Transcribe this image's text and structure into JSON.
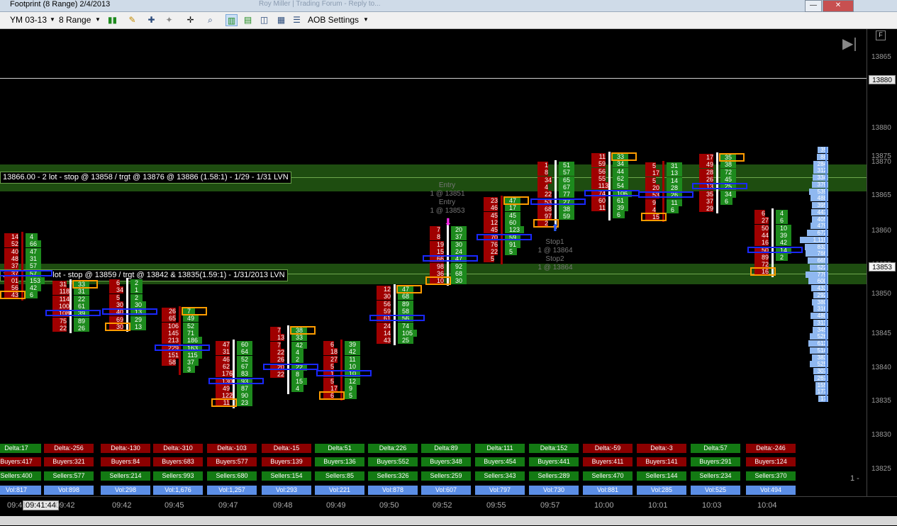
{
  "window": {
    "title": "Footprint (8 Range)  2/4/2013",
    "background_tab_text": "Roy Miller | Trading Forum - Reply to...",
    "min_label": "—",
    "close_label": "✕"
  },
  "toolbar": {
    "instrument": "YM 03-13",
    "period": "8 Range",
    "settings_label": "AOB Settings"
  },
  "price_axis": {
    "ticks": [
      "13865",
      "13880",
      "13875",
      "13870",
      "13865",
      "13860",
      "13855",
      "13850",
      "13845",
      "13840",
      "13835",
      "13830",
      "13825"
    ],
    "current_price": "13853",
    "ref_price": "13880",
    "f_label": "F"
  },
  "chart": {
    "trade_label_upper": "13866.00 - 2 lot - stop @ 13858 / trgt @ 13876 @ 13886 (1.58:1) - 1/29 - 1/31 LVN",
    "trade_label_lower_a": "13 ",
    "trade_label_lower_b": "lot - sto",
    "trade_label_lower_c": "p @ 13859 / trgt @ 13842 & 13835(1.59:1) - 1/31/2013 LVN",
    "entry1": "Entry",
    "entry1_price": "1 @ 13851",
    "entry2": "Entry",
    "entry2_price": "1 @ 13853",
    "stop1": "Stop1",
    "stop1_price": "1 @ 13864",
    "stop2": "Stop2",
    "stop2_price": "1 @ 13864",
    "pager": "1 -",
    "colors": {
      "bid": "#a00000",
      "ask": "#1d8a1d",
      "poc": "#1a28ff",
      "imbalance": "#ff9c00",
      "profile": "#8fb8f0"
    }
  },
  "bars": [
    {
      "bid": [
        "14",
        "52",
        "40",
        "48",
        "37",
        "37",
        "01",
        "56",
        "43"
      ],
      "ask": [
        "4",
        "66",
        "47",
        "31",
        "57",
        "57",
        "153",
        "42",
        "6"
      ]
    },
    {
      "bid": [
        "31",
        "118",
        "114",
        "100",
        "108",
        "75",
        "22"
      ],
      "ask": [
        "33",
        "31",
        "22",
        "61",
        "39",
        "89",
        "26"
      ]
    },
    {
      "bid": [
        "6",
        "34",
        "5",
        "30",
        "40",
        "69",
        "30"
      ],
      "ask": [
        "2",
        "1",
        "2",
        "30",
        "13",
        "29",
        "13"
      ]
    },
    {
      "bid": [
        "26",
        "65",
        "106",
        "145",
        "213",
        "229",
        "151",
        "58"
      ],
      "ask": [
        "7",
        "49",
        "52",
        "71",
        "186",
        "163",
        "115",
        "37",
        "3"
      ]
    },
    {
      "bid": [
        "47",
        "31",
        "46",
        "62",
        "176",
        "130",
        "49",
        "122",
        "11"
      ],
      "ask": [
        "60",
        "64",
        "52",
        "67",
        "83",
        "93",
        "87",
        "90",
        "23"
      ]
    },
    {
      "bid": [
        "7",
        "13",
        "7",
        "22",
        "26",
        "20",
        "22"
      ],
      "ask": [
        "38",
        "33",
        "42",
        "4",
        "2",
        "22",
        "8",
        "15",
        "4"
      ]
    },
    {
      "bid": [
        "6",
        "18",
        "27",
        "5",
        "1",
        "5",
        "17",
        "6"
      ],
      "ask": [
        "39",
        "42",
        "11",
        "10",
        "10",
        "12",
        "9",
        "5"
      ]
    },
    {
      "bid": [
        "12",
        "30",
        "56",
        "59",
        "61",
        "24",
        "14",
        "43"
      ],
      "ask": [
        "47",
        "68",
        "89",
        "58",
        "56",
        "74",
        "105",
        "25"
      ]
    },
    {
      "bid": [
        "7",
        "8",
        "19",
        "15",
        "66",
        "98",
        "36",
        "10"
      ],
      "ask": [
        "20",
        "37",
        "30",
        "24",
        "47",
        "92",
        "68",
        "30"
      ]
    },
    {
      "bid": [
        "23",
        "46",
        "45",
        "12",
        "45",
        "70",
        "76",
        "22",
        "5"
      ],
      "ask": [
        "47",
        "17",
        "45",
        "60",
        "123",
        "59",
        "91",
        "5"
      ]
    },
    {
      "bid": [
        "1",
        "8",
        "34",
        "4",
        "22",
        "53",
        "68",
        "97",
        "2"
      ],
      "ask": [
        "51",
        "57",
        "65",
        "67",
        "77",
        "27",
        "38",
        "59"
      ]
    },
    {
      "bid": [
        "11",
        "59",
        "56",
        "55",
        "113",
        "74",
        "60",
        "11"
      ],
      "ask": [
        "33",
        "34",
        "44",
        "62",
        "54",
        "106",
        "61",
        "39",
        "6"
      ]
    },
    {
      "bid": [
        "5",
        "17",
        "5",
        "20",
        "53",
        "9",
        "4",
        "15"
      ],
      "ask": [
        "31",
        "13",
        "14",
        "28",
        "26",
        "11",
        "6"
      ]
    },
    {
      "bid": [
        "17",
        "49",
        "28",
        "26",
        "13",
        "35",
        "37",
        "29"
      ],
      "ask": [
        "35",
        "38",
        "72",
        "45",
        "25",
        "34",
        "6"
      ]
    },
    {
      "bid": [
        "6",
        "27",
        "50",
        "44",
        "16",
        "50",
        "89",
        "72",
        "16"
      ],
      "ask": [
        "4",
        "6",
        "10",
        "39",
        "42",
        "14",
        "2"
      ]
    }
  ],
  "volume_profile": [
    "35",
    "88",
    "284",
    "312",
    "334",
    "379",
    "539",
    "488",
    "395",
    "447",
    "405",
    "479",
    "672",
    "1,119",
    "833",
    "766",
    "665",
    "522",
    "779",
    "600",
    "433",
    "292",
    "380",
    "316",
    "480",
    "313",
    "345",
    "526",
    "613",
    "514",
    "383",
    "525",
    "307",
    "267",
    "155",
    "177",
    "17"
  ],
  "stats": {
    "delta": [
      "Delta:17",
      "Delta:-256",
      "Delta:-130",
      "Delta:-310",
      "Delta:-103",
      "Delta:-15",
      "Delta:51",
      "Delta:226",
      "Delta:89",
      "Delta:111",
      "Delta:152",
      "Delta:-59",
      "Delta:-3",
      "Delta:57",
      "Delta:-246"
    ],
    "buyers": [
      "Buyers:417",
      "Buyers:321",
      "Buyers:84",
      "Buyers:683",
      "Buyers:577",
      "Buyers:139",
      "Buyers:136",
      "Buyers:552",
      "Buyers:348",
      "Buyers:454",
      "Buyers:441",
      "Buyers:411",
      "Buyers:141",
      "Buyers:291",
      "Buyers:124"
    ],
    "sellers": [
      "Sellers:400",
      "Sellers:577",
      "Sellers:214",
      "Sellers:993",
      "Sellers:680",
      "Sellers:154",
      "Sellers:85",
      "Sellers:326",
      "Sellers:259",
      "Sellers:343",
      "Sellers:289",
      "Sellers:470",
      "Sellers:144",
      "Sellers:234",
      "Sellers:370"
    ],
    "vol": [
      "Vol:817",
      "Vol:898",
      "Vol:298",
      "Vol:1,676",
      "Vol:1,257",
      "Vol:293",
      "Vol:221",
      "Vol:878",
      "Vol:607",
      "Vol:797",
      "Vol:730",
      "Vol:881",
      "Vol:285",
      "Vol:525",
      "Vol:494"
    ],
    "delta_colors": [
      "green",
      "red",
      "red",
      "red",
      "red",
      "red",
      "green",
      "green",
      "green",
      "green",
      "green",
      "red",
      "red",
      "green",
      "red"
    ],
    "buyers_colors": [
      "red",
      "red",
      "red",
      "red",
      "red",
      "red",
      "green",
      "green",
      "green",
      "green",
      "green",
      "red",
      "red",
      "green",
      "red"
    ],
    "sellers_colors": [
      "green",
      "green",
      "green",
      "green",
      "green",
      "green",
      "green",
      "green",
      "green",
      "green",
      "green",
      "green",
      "green",
      "green",
      "green"
    ]
  },
  "time_axis": {
    "labels": [
      "09:41",
      "09:42",
      "09:42",
      "09:45",
      "09:47",
      "09:48",
      "09:49",
      "09:50",
      "09:52",
      "09:55",
      "09:57",
      "10:00",
      "10:01",
      "10:03",
      "10:04"
    ],
    "cursor_time": "09:41:44"
  }
}
